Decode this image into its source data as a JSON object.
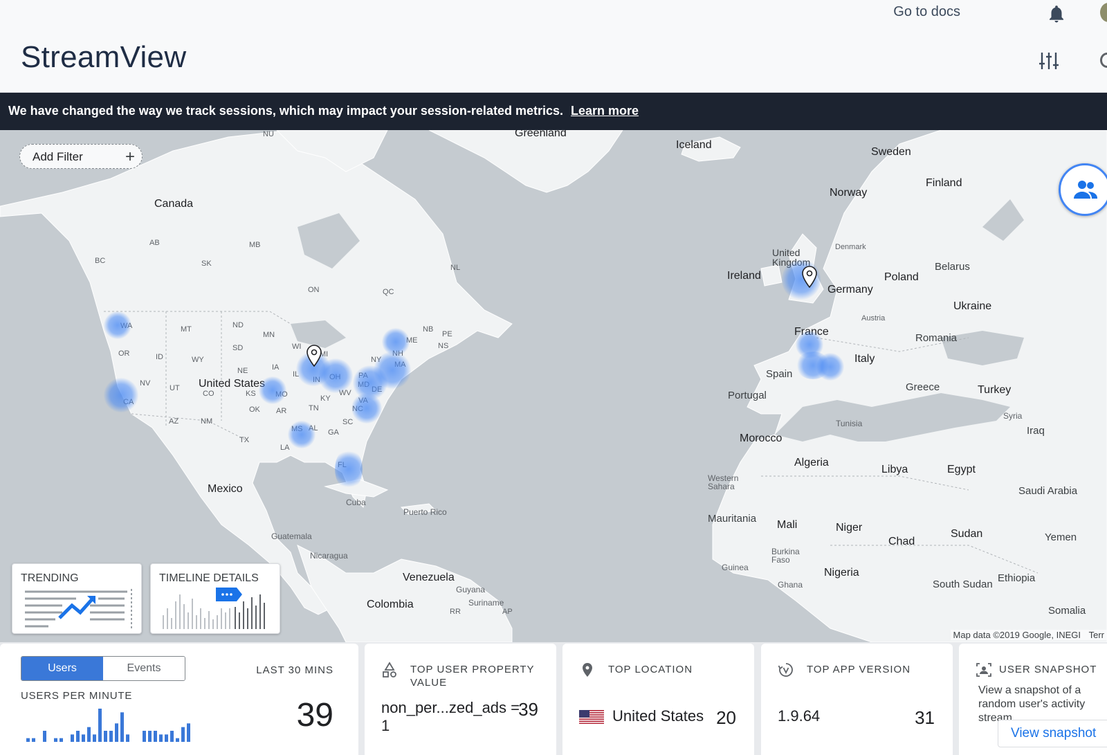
{
  "header": {
    "brand": "StreamView",
    "docs_link": "Go to docs"
  },
  "banner": {
    "message": "We have changed the way we track sessions, which may impact your session-related metrics.",
    "link": "Learn more"
  },
  "map": {
    "add_filter": "Add Filter",
    "attribution": "Map data ©2019 Google, INEGI",
    "terms": "Terr",
    "labels": {
      "countries": [
        "Greenland",
        "Iceland",
        "Sweden",
        "Finland",
        "Norway",
        "Canada",
        "United Kingdom",
        "Denmark",
        "Belarus",
        "Ireland",
        "Poland",
        "Germany",
        "Ukraine",
        "Austria",
        "France",
        "Romania",
        "Italy",
        "Spain",
        "Portugal",
        "Greece",
        "Turkey",
        "United States",
        "Mexico",
        "Cuba",
        "Puerto Rico",
        "Guatemala",
        "Nicaragua",
        "Venezuela",
        "Guyana",
        "Suriname",
        "Colombia",
        "Tunisia",
        "Syria",
        "Iraq",
        "Morocco",
        "Algeria",
        "Libya",
        "Egypt",
        "Saudi Arabia",
        "Western Sahara",
        "Mauritania",
        "Mali",
        "Niger",
        "Chad",
        "Sudan",
        "Yemen",
        "Burkina Faso",
        "Guinea",
        "Nigeria",
        "Ghana",
        "Ethiopia",
        "South Sudan",
        "Somalia"
      ],
      "regions": [
        "NU",
        "AB",
        "MB",
        "SK",
        "BC",
        "NL",
        "ON",
        "QC",
        "WA",
        "MT",
        "ND",
        "MN",
        "OR",
        "ID",
        "SD",
        "WY",
        "NE",
        "IA",
        "WI",
        "MI",
        "NY",
        "NH",
        "ME",
        "MA",
        "NB",
        "PE",
        "NS",
        "IL",
        "IN",
        "OH",
        "PA",
        "MD",
        "DE",
        "NV",
        "UT",
        "CO",
        "KS",
        "MO",
        "KY",
        "WV",
        "VA",
        "CA",
        "AZ",
        "NM",
        "OK",
        "AR",
        "TN",
        "NC",
        "SC",
        "TX",
        "MS",
        "AL",
        "GA",
        "LA",
        "FL",
        "RR",
        "AP"
      ]
    },
    "cards": {
      "trending": "TRENDING",
      "timeline": "TIMELINE DETAILS"
    }
  },
  "users_card": {
    "toggle": [
      "Users",
      "Events"
    ],
    "active_toggle": "Users",
    "subtitle": "USERS PER MINUTE",
    "period": "LAST 30 MINS",
    "value": "39",
    "bar_values": [
      1,
      1,
      0,
      3,
      0,
      1,
      1,
      0,
      2,
      3,
      2,
      4,
      2,
      9,
      3,
      3,
      5,
      8,
      2,
      0,
      0,
      3,
      3,
      3,
      2,
      2,
      3,
      1,
      4,
      5
    ]
  },
  "property_card": {
    "title": "TOP USER PROPERTY VALUE",
    "name": "non_per...zed_ads = 1",
    "value": "39"
  },
  "location_card": {
    "title": "TOP LOCATION",
    "name": "United States",
    "value": "20"
  },
  "version_card": {
    "title": "TOP APP VERSION",
    "name": "1.9.64",
    "value": "31"
  },
  "snapshot_card": {
    "title": "USER SNAPSHOT",
    "text": "View a snapshot of a random user's activity stream",
    "button": "View snapshot"
  },
  "colors": {
    "accent": "#3a78d8",
    "banner_bg": "#1c2330",
    "heat": "#4285f4",
    "land": "#f1f3f4",
    "water": "#c5cbd0"
  }
}
